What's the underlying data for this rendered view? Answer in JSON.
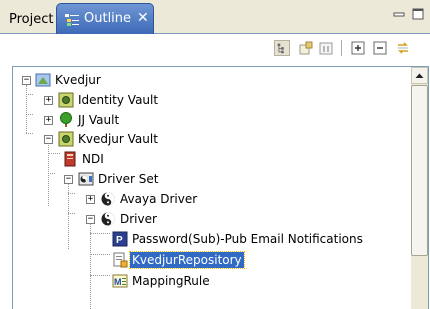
{
  "tabs": {
    "project_label": "Project",
    "outline_label": "Outline",
    "outline_close": "✕"
  },
  "toolbar": {
    "buttons": [
      "hierarchical-view-icon",
      "show-objects-icon",
      "filter-icon",
      "expand-all-icon",
      "collapse-all-icon",
      "sync-icon"
    ]
  },
  "tree": {
    "root": {
      "label": "Kvedjur"
    },
    "identity_vault": {
      "label": "Identity Vault"
    },
    "jj_vault": {
      "label": "JJ Vault"
    },
    "kvedjur_vault": {
      "label": "Kvedjur Vault"
    },
    "ndi": {
      "label": "NDI"
    },
    "driver_set": {
      "label": "Driver Set"
    },
    "avaya_driver": {
      "label": "Avaya Driver"
    },
    "driver": {
      "label": "Driver"
    },
    "password_pub": {
      "label": "Password(Sub)-Pub Email Notifications"
    },
    "kvedjur_repository": {
      "label": "KvedjurRepository"
    },
    "mapping_rule": {
      "label": "MappingRule"
    }
  },
  "colors": {
    "selection": "#316ac5",
    "tab_active": "#4a78c4",
    "chrome": "#ece9d8"
  }
}
